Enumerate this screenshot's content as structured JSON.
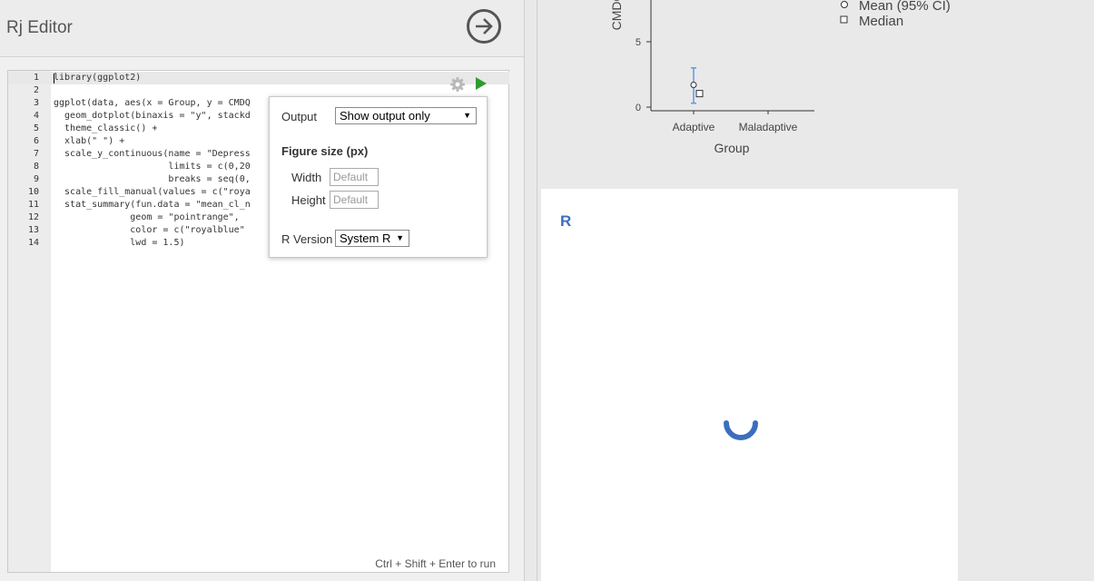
{
  "editor": {
    "title": "Rj Editor",
    "hint": "Ctrl + Shift + Enter to run",
    "lines": [
      {
        "num": "1",
        "code": "library(ggplot2)"
      },
      {
        "num": "2",
        "code": ""
      },
      {
        "num": "3",
        "code": "ggplot(data, aes(x = Group, y = CMDQ"
      },
      {
        "num": "4",
        "code": "  geom_dotplot(binaxis = \"y\", stackd"
      },
      {
        "num": "5",
        "code": "  theme_classic() +"
      },
      {
        "num": "6",
        "code": "  xlab(\" \") +"
      },
      {
        "num": "7",
        "code": "  scale_y_continuous(name = \"Depress"
      },
      {
        "num": "8",
        "code": "                     limits = c(0,20"
      },
      {
        "num": "9",
        "code": "                     breaks = seq(0,"
      },
      {
        "num": "10",
        "code": "  scale_fill_manual(values = c(\"roya"
      },
      {
        "num": "11",
        "code": "  stat_summary(fun.data = \"mean_cl_n"
      },
      {
        "num": "12",
        "code": "              geom = \"pointrange\","
      },
      {
        "num": "13",
        "code": "              color = c(\"royalblue\""
      },
      {
        "num": "14",
        "code": "              lwd = 1.5)"
      }
    ]
  },
  "options": {
    "output_label": "Output",
    "output_value": "Show output only",
    "figure_size_label": "Figure size (px)",
    "width_label": "Width",
    "width_placeholder": "Default",
    "height_label": "Height",
    "height_placeholder": "Default",
    "r_version_label": "R Version",
    "r_version_value": "System R"
  },
  "chart_data": {
    "type": "scatter",
    "ylabel": "CMDQ",
    "xlabel": "Group",
    "categories": [
      "Adaptive",
      "Maladaptive"
    ],
    "y_ticks": [
      "0",
      "5"
    ],
    "legend": [
      "Mean (95% CI)",
      "Median"
    ],
    "series": [
      {
        "name": "Mean (95% CI)",
        "category": "Adaptive",
        "value": 1.7,
        "ci": [
          0.3,
          3.0
        ]
      },
      {
        "name": "Median",
        "category": "Adaptive",
        "value": 1.0
      }
    ]
  },
  "result": {
    "label": "R"
  },
  "colors": {
    "accent_blue": "#3c6ebf",
    "run_green": "#2e9c2e",
    "ci_blue": "#6b9be8"
  }
}
